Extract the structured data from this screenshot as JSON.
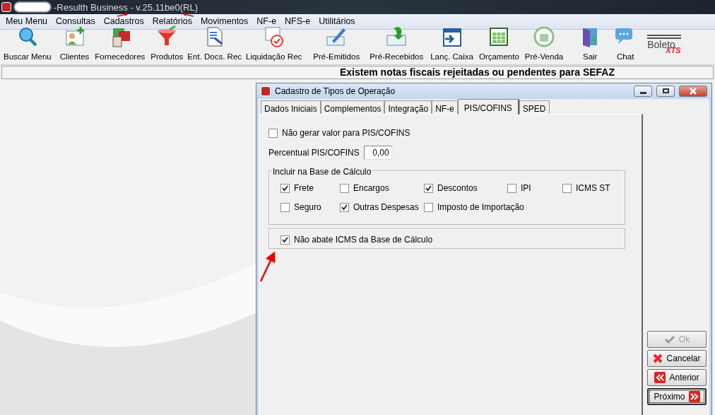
{
  "window": {
    "title": "-Resulth Business - v.25.11be0(RL)"
  },
  "menu": [
    "Meu Menu",
    "Consultas",
    "Cadastros",
    "Relatórios",
    "Movimentos",
    "NF-e",
    "NFS-e",
    "Utilitários"
  ],
  "toolbar": [
    {
      "label": "Buscar Menu"
    },
    {
      "label": "Clientes"
    },
    {
      "label": "Fornecedores"
    },
    {
      "label": "Produtos"
    },
    {
      "label": "Ent. Docs. Rec"
    },
    {
      "label": "Liquidação Rec"
    },
    {
      "label": "Pré-Emitidos"
    },
    {
      "label": "Pré-Recebidos"
    },
    {
      "label": "Lanç. Caixa"
    },
    {
      "label": "Orçamento"
    },
    {
      "label": "Pré-Venda"
    },
    {
      "label": "Sair"
    },
    {
      "label": "Chat"
    }
  ],
  "logo": {
    "word": "Boleto",
    "mark": "XTS"
  },
  "notice": "Existem notas fiscais rejeitadas ou pendentes para SEFAZ",
  "dialog": {
    "title": "Cadastro de Tipos de Operação",
    "tabs": [
      {
        "label": "Dados Iniciais",
        "selected": false
      },
      {
        "label": "Complementos",
        "selected": false
      },
      {
        "label": "Integração",
        "selected": false
      },
      {
        "label": "NF-e",
        "selected": false
      },
      {
        "label": "PIS/COFINS",
        "selected": true
      },
      {
        "label": "SPED",
        "selected": false
      }
    ],
    "no_value": {
      "label": "Não gerar valor para PIS/COFINS",
      "checked": false
    },
    "percent": {
      "label": "Percentual PIS/COFINS",
      "value": "0,00"
    },
    "base_group": {
      "title": "Incluir na Base de Cálculo",
      "rows": [
        [
          {
            "label": "Frete",
            "checked": true
          },
          {
            "label": "Encargos",
            "checked": false
          },
          {
            "label": "Descontos",
            "checked": true
          },
          {
            "label": "IPI",
            "checked": false
          },
          {
            "label": "ICMS ST",
            "checked": false
          }
        ],
        [
          {
            "label": "Seguro",
            "checked": false
          },
          {
            "label": "Outras Despesas",
            "checked": true
          },
          {
            "label": "Imposto de Importação",
            "checked": false
          }
        ]
      ]
    },
    "no_deduct": {
      "label": "Não abate ICMS da Base de Cálculo",
      "checked": true
    },
    "buttons": [
      {
        "label": "Ok",
        "kind": "ok",
        "disabled": true
      },
      {
        "label": "Cancelar",
        "kind": "cancel",
        "disabled": false
      },
      {
        "label": "Anterior",
        "kind": "prev",
        "disabled": false
      },
      {
        "label": "Próximo",
        "kind": "next",
        "disabled": false
      }
    ]
  }
}
